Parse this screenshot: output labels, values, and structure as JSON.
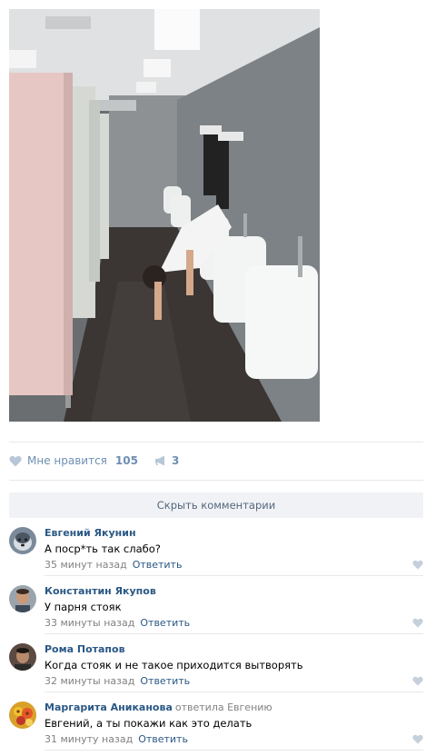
{
  "post": {
    "photo_icon": "photo-handstand-urinal",
    "likes_label": "Мне нравится",
    "likes_count": "105",
    "shares_count": "3",
    "hide_comments": "Скрыть комментарии"
  },
  "comments": [
    {
      "author": "Евгений Якунин",
      "replied_to": "",
      "text": "А поср*ть так слабо?",
      "time": "35 минут назад",
      "reply": "Ответить",
      "avatar_icon": "avatar-husky",
      "avatar_color": "#7a8a9a"
    },
    {
      "author": "Константин Якупов",
      "replied_to": "",
      "text": "У парня стояк",
      "time": "33 минуты назад",
      "reply": "Ответить",
      "avatar_icon": "avatar-photo",
      "avatar_color": "#8b6a55"
    },
    {
      "author": "Рома Потапов",
      "replied_to": "",
      "text": "Когда стояк и не такое приходится вытворять",
      "time": "32 минуты назад",
      "reply": "Ответить",
      "avatar_icon": "avatar-photo",
      "avatar_color": "#5a4a42"
    },
    {
      "author": "Маргарита Аниканова",
      "replied_to": "ответила Евгению",
      "text": "Евгений, а ты покажи как это делать",
      "time": "31 минуту назад",
      "reply": "Ответить",
      "avatar_icon": "avatar-flowers",
      "avatar_color": "#d9a12a"
    }
  ],
  "colors": {
    "link": "#2a5885",
    "action": "#6d8fb3",
    "meta": "#828282",
    "divider": "#e7e8ec",
    "button_bg": "#f0f2f5"
  }
}
